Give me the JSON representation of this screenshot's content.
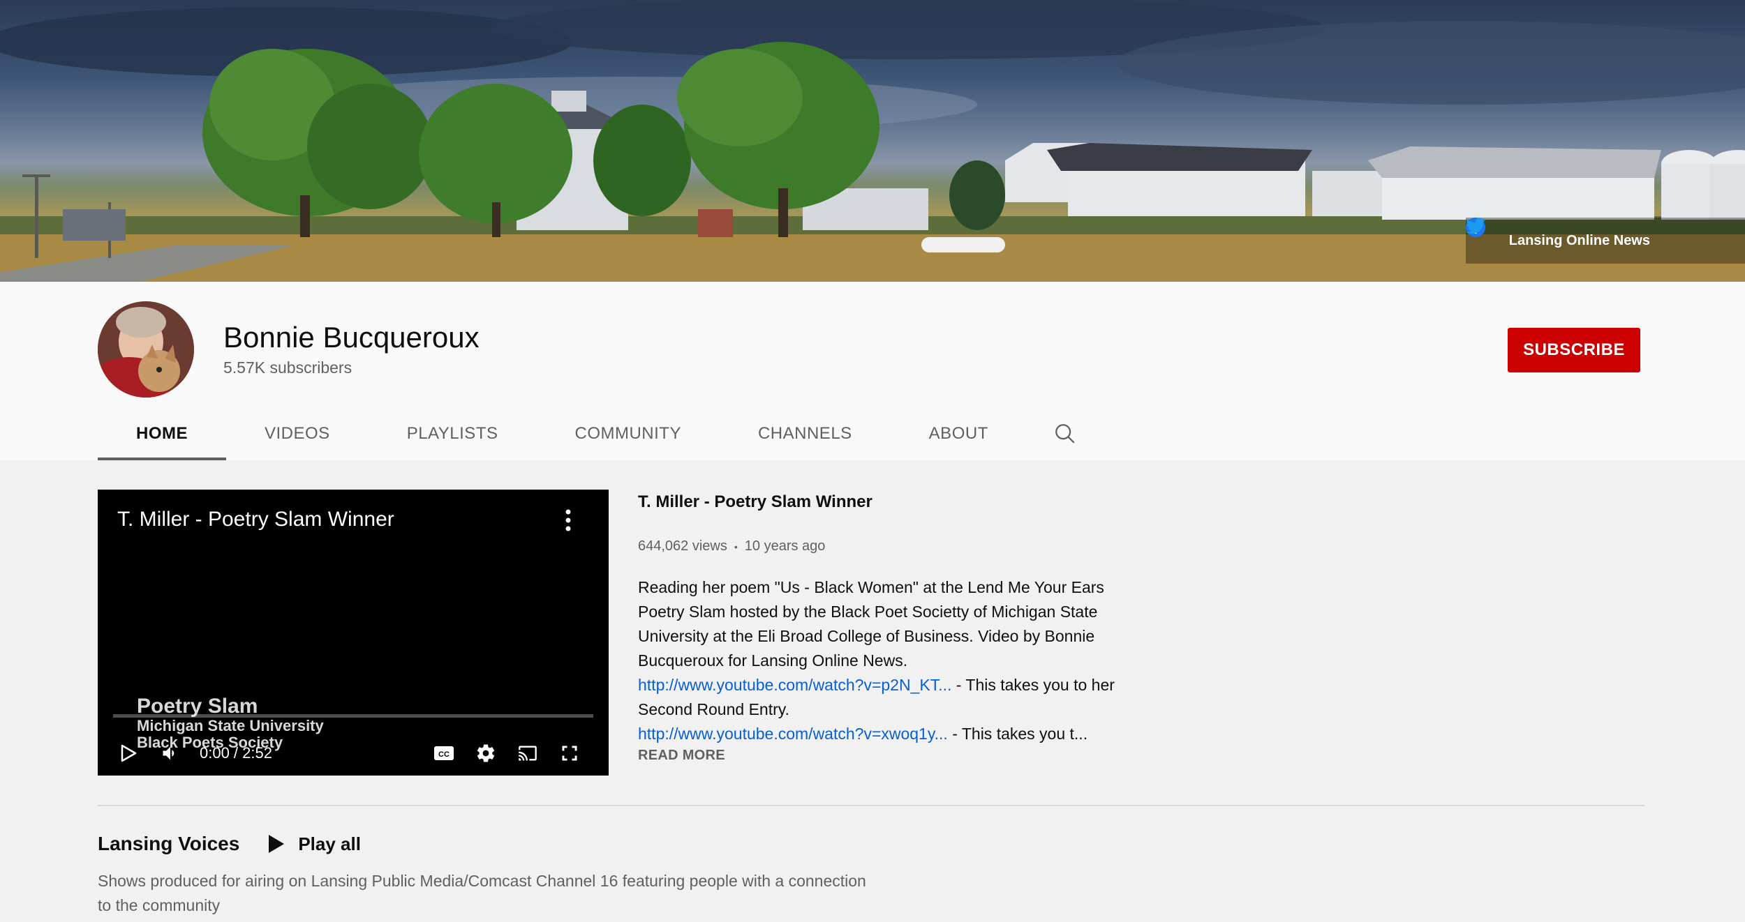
{
  "banner": {
    "link_text": "Lansing Online News",
    "social_icons": [
      "facebook-icon",
      "twitter-icon"
    ]
  },
  "channel": {
    "name": "Bonnie Bucqueroux",
    "subscribers": "5.57K subscribers",
    "subscribe_label": "SUBSCRIBE",
    "subscribe_color": "#cc0000"
  },
  "tabs": [
    {
      "label": "HOME",
      "active": true
    },
    {
      "label": "VIDEOS",
      "active": false
    },
    {
      "label": "PLAYLISTS",
      "active": false
    },
    {
      "label": "COMMUNITY",
      "active": false
    },
    {
      "label": "CHANNELS",
      "active": false
    },
    {
      "label": "ABOUT",
      "active": false
    }
  ],
  "featured_video": {
    "player_title": "T. Miller - Poetry Slam Winner",
    "overlay_lines": [
      "Poetry Slam",
      "Michigan State University",
      "Black Poets Society"
    ],
    "time": "0:00 / 2:52",
    "progress": 0,
    "title": "T. Miller - Poetry Slam Winner",
    "views": "644,062 views",
    "age": "10 years ago",
    "description_1": "Reading her poem \"Us - Black Women\" at the Lend Me Your Ears Poetry Slam hosted by the Black Poet Societty of Michigan State University at the Eli Broad College of Business. Video by Bonnie Bucqueroux for Lansing Online News.",
    "link_1": "http://www.youtube.com/watch?v=p2N_KT...",
    "link_1_text": " - This takes you to her Second Round Entry.",
    "link_2": "http://www.youtube.com/watch?v=xwoq1y...",
    "link_2_text": " - This takes you t...",
    "read_more": "READ MORE"
  },
  "shelf": {
    "title": "Lansing Voices",
    "play_all": "Play all",
    "description": "Shows produced for airing on Lansing Public Media/Comcast Channel 16 featuring people with a connection to the community"
  }
}
